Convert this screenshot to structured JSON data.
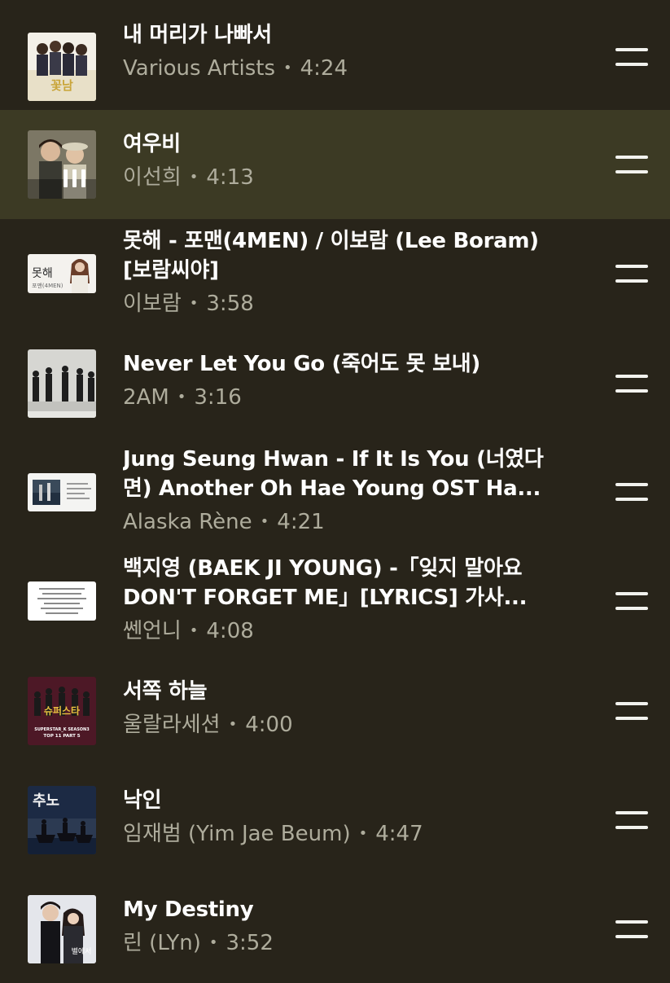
{
  "colors": {
    "background": "#28241a",
    "active_row_background": "#3c3a24",
    "title_text": "#ffffff",
    "subtitle_text": "#aeac9c"
  },
  "queue": [
    {
      "title": "내 머리가 나빠서",
      "artist": "Various Artists",
      "duration": "4:24",
      "thumbnail": "boys-over-flowers-album-art",
      "now_playing": false
    },
    {
      "title": "여우비",
      "artist": "이선희",
      "duration": "4:13",
      "thumbnail": "two-singers-album-art",
      "now_playing": true
    },
    {
      "title": "못해 - 포맨(4MEN) / 이보람 (Lee Boram) [보람씨야]",
      "artist": "이보람",
      "duration": "3:58",
      "thumbnail": "singer-video-thumbnail",
      "thumb_text": "못해",
      "thumb_subtext": "포맨(4MEN)",
      "now_playing": false
    },
    {
      "title": "Never Let You Go (죽어도 못 보내)",
      "artist": "2AM",
      "duration": "3:16",
      "thumbnail": "group-photo-album-art",
      "now_playing": false
    },
    {
      "title": "Jung Seung Hwan -  If It Is You (너였다면)  Another Oh Hae Young OST  Ha...",
      "artist": "Alaska Rène",
      "duration": "4:21",
      "thumbnail": "lyrics-video-thumbnail",
      "now_playing": false
    },
    {
      "title": "백지영 (BAEK JI YOUNG) -「잊지 말아요 DON'T FORGET ME」[LYRICS] 가사...",
      "artist": "쎈언니",
      "duration": "4:08",
      "thumbnail": "lyrics-text-thumbnail",
      "now_playing": false
    },
    {
      "title": "서쪽 하늘",
      "artist": "울랄라세션",
      "duration": "4:00",
      "thumbnail": "superstar-k-album-art",
      "thumb_text": "SUPERSTAR_K SEASON3",
      "thumb_subtext": "TOP 11 PART 5",
      "now_playing": false
    },
    {
      "title": "낙인",
      "artist": "임재범 (Yim Jae Beum)",
      "duration": "4:47",
      "thumbnail": "chuno-album-art",
      "thumb_text": "추노",
      "now_playing": false
    },
    {
      "title": "My Destiny",
      "artist": "린 (LYn)",
      "duration": "3:52",
      "thumbnail": "drama-couple-album-art",
      "now_playing": false
    }
  ],
  "icons": {
    "drag_handle": "drag-handle-icon",
    "now_playing": "now-playing-bars-icon"
  }
}
